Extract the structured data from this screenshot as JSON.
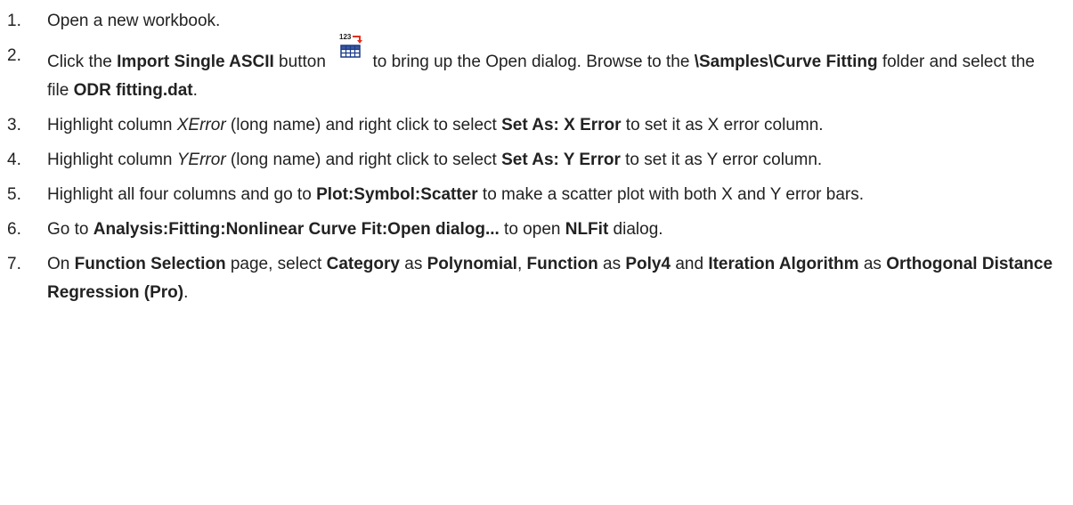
{
  "steps": [
    {
      "num": "1.",
      "parts": [
        {
          "t": "Open a new workbook."
        }
      ]
    },
    {
      "num": "2.",
      "parts": [
        {
          "t": "Click the "
        },
        {
          "t": "Import Single ASCII",
          "s": "b"
        },
        {
          "t": " button "
        },
        {
          "icon": "import-single-ascii-icon"
        },
        {
          "t": "to bring up the Open dialog. Browse to the "
        },
        {
          "t": "\\Samples\\Curve Fitting",
          "s": "b"
        },
        {
          "t": " folder and select the file "
        },
        {
          "t": "ODR fitting.dat",
          "s": "b"
        },
        {
          "t": "."
        }
      ]
    },
    {
      "num": "3.",
      "parts": [
        {
          "t": "Highlight column "
        },
        {
          "t": "XError",
          "s": "i"
        },
        {
          "t": " (long name) and right click to select "
        },
        {
          "t": "Set As: X Error",
          "s": "b"
        },
        {
          "t": " to set it as X error column."
        }
      ]
    },
    {
      "num": "4.",
      "parts": [
        {
          "t": "Highlight column "
        },
        {
          "t": "YError",
          "s": "i"
        },
        {
          "t": " (long name) and right click to select "
        },
        {
          "t": "Set As: Y Error",
          "s": "b"
        },
        {
          "t": " to set it as Y error column."
        }
      ]
    },
    {
      "num": "5.",
      "parts": [
        {
          "t": "Highlight all four columns and go to "
        },
        {
          "t": "Plot:Symbol:Scatter",
          "s": "b"
        },
        {
          "t": " to make a scatter plot with both X and Y error bars."
        }
      ]
    },
    {
      "num": "6.",
      "parts": [
        {
          "t": "Go to "
        },
        {
          "t": "Analysis:Fitting:Nonlinear Curve Fit:Open dialog...",
          "s": "b"
        },
        {
          "t": " to open "
        },
        {
          "t": "NLFit",
          "s": "b"
        },
        {
          "t": " dialog."
        }
      ]
    },
    {
      "num": "7.",
      "parts": [
        {
          "t": "On "
        },
        {
          "t": "Function Selection",
          "s": "b"
        },
        {
          "t": " page, select "
        },
        {
          "t": "Category",
          "s": "b"
        },
        {
          "t": " as "
        },
        {
          "t": "Polynomial",
          "s": "b"
        },
        {
          "t": ", "
        },
        {
          "t": "Function",
          "s": "b"
        },
        {
          "t": " as "
        },
        {
          "t": "Poly4",
          "s": "b"
        },
        {
          "t": " and "
        },
        {
          "t": "Iteration Algorithm",
          "s": "b"
        },
        {
          "t": " as "
        },
        {
          "t": "Orthogonal Distance Regression (Pro)",
          "s": "b"
        },
        {
          "t": "."
        }
      ]
    }
  ],
  "icon_badge_text": "123",
  "colors": {
    "text": "#222222",
    "icon_arrow": "#e03020",
    "icon_grid": "#1a3a8a"
  }
}
